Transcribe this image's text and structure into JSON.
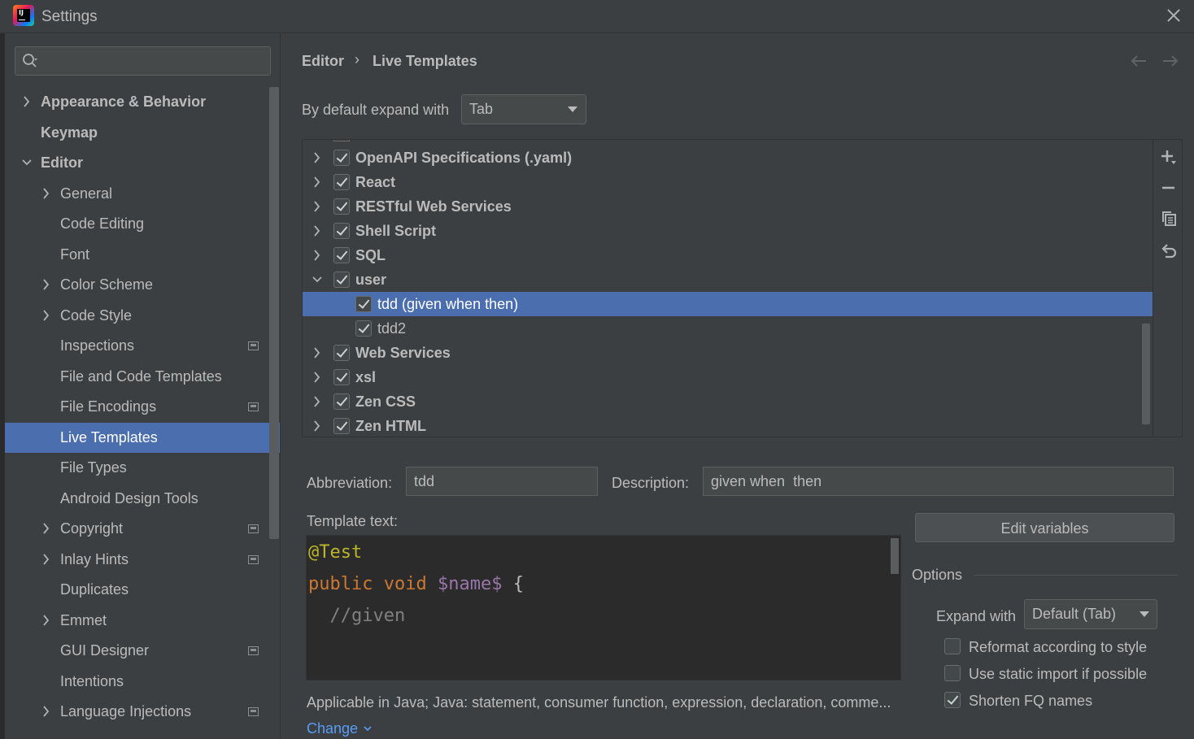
{
  "window": {
    "title": "Settings",
    "logo_text": "IJ"
  },
  "sidebar": {
    "search": {
      "placeholder": "",
      "value": ""
    },
    "items": [
      {
        "label": "Appearance & Behavior",
        "level": 0,
        "bold": true,
        "expander": "collapsed"
      },
      {
        "label": "Keymap",
        "level": 0,
        "bold": true,
        "expander": "none"
      },
      {
        "label": "Editor",
        "level": 0,
        "bold": true,
        "expander": "expanded"
      },
      {
        "label": "General",
        "level": 1,
        "expander": "collapsed"
      },
      {
        "label": "Code Editing",
        "level": 1,
        "expander": "none"
      },
      {
        "label": "Font",
        "level": 1,
        "expander": "none"
      },
      {
        "label": "Color Scheme",
        "level": 1,
        "expander": "collapsed"
      },
      {
        "label": "Code Style",
        "level": 1,
        "expander": "collapsed"
      },
      {
        "label": "Inspections",
        "level": 1,
        "expander": "none",
        "project_icon": true
      },
      {
        "label": "File and Code Templates",
        "level": 1,
        "expander": "none"
      },
      {
        "label": "File Encodings",
        "level": 1,
        "expander": "none",
        "project_icon": true
      },
      {
        "label": "Live Templates",
        "level": 1,
        "expander": "none",
        "selected": true
      },
      {
        "label": "File Types",
        "level": 1,
        "expander": "none"
      },
      {
        "label": "Android Design Tools",
        "level": 1,
        "expander": "none"
      },
      {
        "label": "Copyright",
        "level": 1,
        "expander": "collapsed",
        "project_icon": true
      },
      {
        "label": "Inlay Hints",
        "level": 1,
        "expander": "collapsed",
        "project_icon": true
      },
      {
        "label": "Duplicates",
        "level": 1,
        "expander": "none"
      },
      {
        "label": "Emmet",
        "level": 1,
        "expander": "collapsed"
      },
      {
        "label": "GUI Designer",
        "level": 1,
        "expander": "none",
        "project_icon": true
      },
      {
        "label": "Intentions",
        "level": 1,
        "expander": "none"
      },
      {
        "label": "Language Injections",
        "level": 1,
        "expander": "collapsed",
        "project_icon": true
      }
    ]
  },
  "breadcrumb": {
    "parent": "Editor",
    "separator": "›",
    "current": "Live Templates"
  },
  "expand": {
    "label": "By default expand with",
    "value": "Tab"
  },
  "templates": [
    {
      "label": "OpenAPI Specifications (.yaml)",
      "type": "group",
      "checked": true,
      "expander": "collapsed"
    },
    {
      "label": "React",
      "type": "group",
      "checked": true,
      "expander": "collapsed"
    },
    {
      "label": "RESTful Web Services",
      "type": "group",
      "checked": true,
      "expander": "collapsed"
    },
    {
      "label": "Shell Script",
      "type": "group",
      "checked": true,
      "expander": "collapsed"
    },
    {
      "label": "SQL",
      "type": "group",
      "checked": true,
      "expander": "collapsed"
    },
    {
      "label": "user",
      "type": "group",
      "checked": true,
      "expander": "expanded"
    },
    {
      "label": "tdd (given when  then)",
      "type": "item",
      "checked": true,
      "selected": true
    },
    {
      "label": "tdd2",
      "type": "item",
      "checked": true
    },
    {
      "label": "Web Services",
      "type": "group",
      "checked": true,
      "expander": "collapsed"
    },
    {
      "label": "xsl",
      "type": "group",
      "checked": true,
      "expander": "collapsed"
    },
    {
      "label": "Zen CSS",
      "type": "group",
      "checked": true,
      "expander": "collapsed"
    },
    {
      "label": "Zen HTML",
      "type": "group",
      "checked": true,
      "expander": "collapsed"
    }
  ],
  "toolbar": {
    "add": "+",
    "remove": "−"
  },
  "form": {
    "abbreviation_label": "Abbreviation:",
    "abbreviation_value": "tdd",
    "description_label": "Description:",
    "description_value": "given when  then",
    "template_text_label": "Template text:",
    "edit_variables_label": "Edit variables"
  },
  "editor": {
    "line1": "@Test",
    "line2_kw1": "public",
    "line2_kw2": "void",
    "line2_var": "$name$",
    "line2_brace": "{",
    "line3": "  //given"
  },
  "options": {
    "title": "Options",
    "expand_with_label": "Expand with",
    "expand_with_value": "Default (Tab)",
    "checks": [
      {
        "label": "Reformat according to style",
        "checked": false
      },
      {
        "label": "Use static import if possible",
        "checked": false
      },
      {
        "label": "Shorten FQ names",
        "checked": true
      }
    ]
  },
  "applicable": {
    "text": "Applicable in Java; Java: statement, consumer function, expression, declaration, comme...",
    "change_label": "Change"
  },
  "colors": {
    "selection": "#4b6eaf",
    "background": "#3c3f41",
    "link": "#589df6"
  }
}
